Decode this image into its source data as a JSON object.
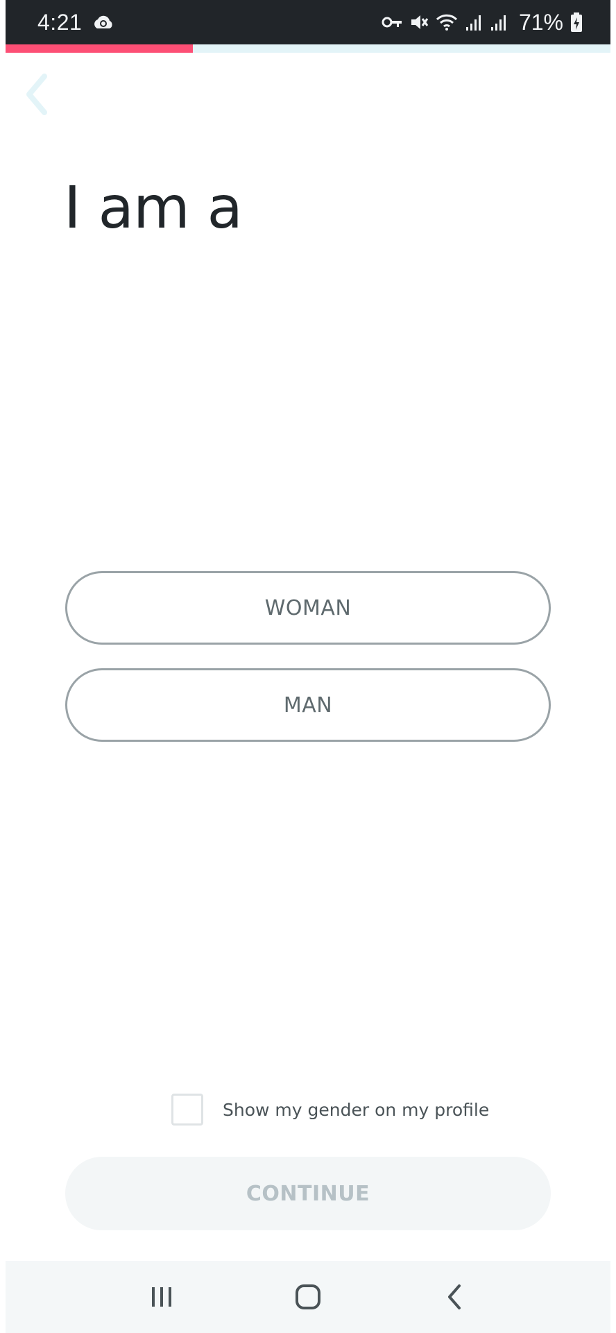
{
  "status_bar": {
    "time": "4:21",
    "battery_percent": "71%",
    "icons": [
      "cloud-sync-icon",
      "vpn-key-icon",
      "mute-icon",
      "wifi-icon",
      "signal-icon",
      "signal-icon",
      "battery-charging-icon"
    ]
  },
  "progress": {
    "fraction": 0.31,
    "fill_color": "#fd4f75",
    "track_color": "#e3f4f8"
  },
  "header": {
    "back_icon": "chevron-left-icon"
  },
  "page": {
    "title": "I am a"
  },
  "options": {
    "woman_label": "WOMAN",
    "man_label": "MAN"
  },
  "gender_toggle": {
    "label": "Show my gender on my profile",
    "checked": false
  },
  "footer": {
    "continue_label": "CONTINUE",
    "continue_enabled": false
  },
  "nav_bar": {
    "icons": [
      "recent-apps-icon",
      "home-icon",
      "back-icon"
    ]
  }
}
